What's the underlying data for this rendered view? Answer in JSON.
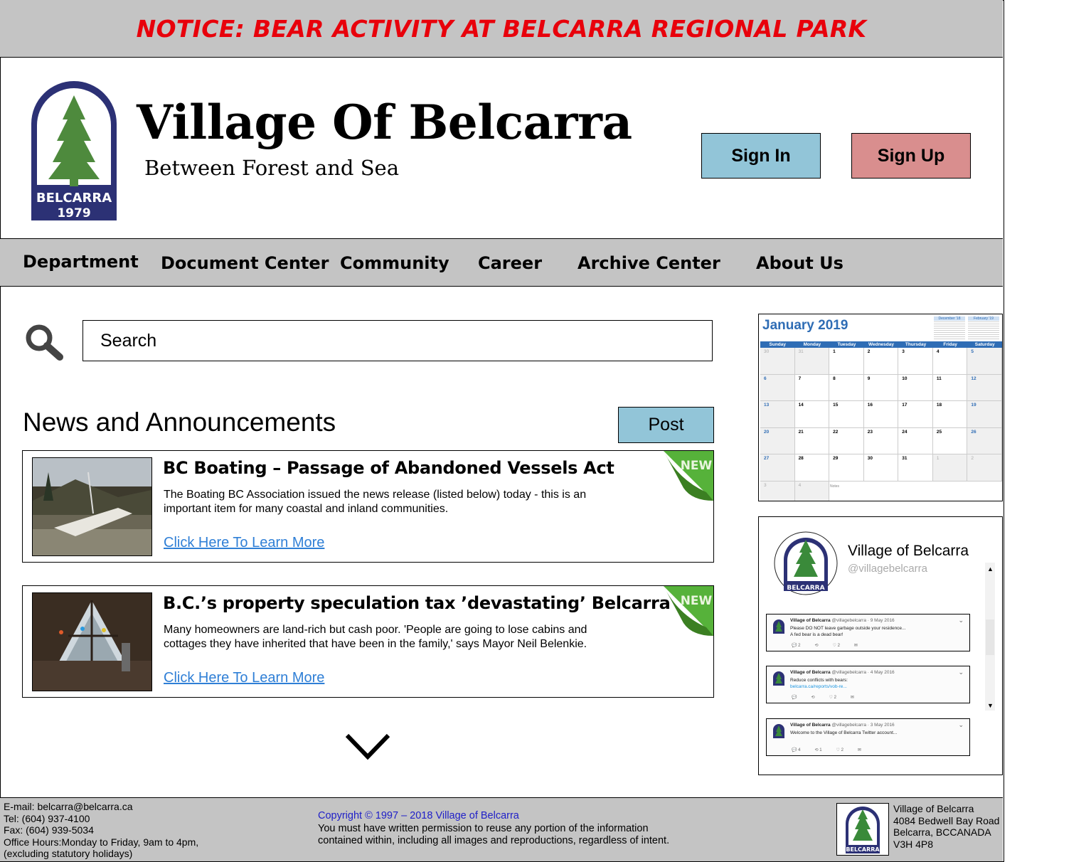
{
  "notice": {
    "text": "NOTICE: BEAR ACTIVITY AT BELCARRA REGIONAL PARK",
    "color": "#e8000b"
  },
  "header": {
    "logo": {
      "icon": "belcarra-crest-logo",
      "text_line1": "BELCARRA",
      "text_line2": "1979"
    },
    "title": "Village Of Belcarra",
    "tagline": "Between Forest and Sea",
    "sign_in": "Sign In",
    "sign_up": "Sign Up"
  },
  "nav": {
    "items": [
      "Department",
      "Document Center",
      "Community",
      "Career",
      "Archive Center",
      "About Us"
    ]
  },
  "search": {
    "placeholder": "Search",
    "icon": "search-icon"
  },
  "news": {
    "title": "News and Announcements",
    "post_label": "Post",
    "items": [
      {
        "headline": "BC Boating – Passage of Abandoned Vessels Act",
        "body": "The Boating BC Association issued the news release (listed below) today - this is an important item for many coastal and inland communities.",
        "link": "Click Here To Learn More",
        "badge": "NEW"
      },
      {
        "headline": "B.C.’s property speculation tax ’devastating’ Belcarra",
        "body": "Many homeowners are land-rich but cash poor. 'People are going to lose cabins and cottages they have inherited that have been in the family,' says Mayor Neil Belenkie.",
        "link": "Click Here To Learn More",
        "badge": "NEW"
      }
    ]
  },
  "calendar": {
    "month": "January 2019",
    "mini": [
      "December '18",
      "February '19"
    ],
    "weekdays": [
      "Sunday",
      "Monday",
      "Tuesday",
      "Wednesday",
      "Thursday",
      "Friday",
      "Saturday"
    ],
    "days": [
      "30",
      "31",
      "1",
      "2",
      "3",
      "4",
      "5",
      "6",
      "7",
      "8",
      "9",
      "10",
      "11",
      "12",
      "13",
      "14",
      "15",
      "16",
      "17",
      "18",
      "19",
      "20",
      "21",
      "22",
      "23",
      "24",
      "25",
      "26",
      "27",
      "28",
      "29",
      "30",
      "31",
      "1",
      "2",
      "3",
      "4"
    ],
    "notes": "Notes"
  },
  "twitter": {
    "name": "Village of Belcarra",
    "handle": "@villagebelcarra",
    "tweets": [
      {
        "author": "Village of Belcarra",
        "meta": "@villagebelcarra · 9 May 2016",
        "line1": "Please DO NOT leave garbage outside your residence...",
        "line2": "A fed bear is a dead bear!",
        "url": "",
        "replies": "2",
        "retweets": "",
        "likes": "2"
      },
      {
        "author": "Village of Belcarra",
        "meta": "@villagebelcarra · 4 May 2016",
        "line1": "Reduce conflicts with bears:",
        "line2": "",
        "url": "belcarra.ca/reports/vob-re...",
        "replies": "",
        "retweets": "",
        "likes": "2"
      },
      {
        "author": "Village of Belcarra",
        "meta": "@villagebelcarra · 3 May 2016",
        "line1": "Welcome to the Village of Belcarra Twitter account...",
        "line2": "",
        "url": "",
        "replies": "4",
        "retweets": "1",
        "likes": "2"
      }
    ]
  },
  "footer": {
    "email": "E-mail: belcarra@belcarra.ca",
    "tel": "Tel: (604) 937-4100",
    "fax": "Fax: (604) 939-5034",
    "hours": "Office Hours:Monday to Friday, 9am to 4pm,",
    "hours_note": "(excluding statutory holidays)",
    "copyright": "Copyright © 1997 – 2018 Village of Belcarra",
    "permission_line1": "You must have written permission to reuse any portion of the information",
    "permission_line2": "contained within, including all images and reproductions, regardless of intent.",
    "address_line1": "Village of Belcarra",
    "address_line2": "4084 Bedwell Bay Road",
    "address_line3": "Belcarra, BCCANADA",
    "address_line4": "V3H 4P8",
    "logo_text": "BELCARRA"
  },
  "colors": {
    "banner_gray": "#c4c4c4",
    "sign_in": "#92c5d8",
    "sign_up": "#d98e8e",
    "link": "#2f7fd6",
    "calendar_blue": "#2f6db5",
    "crest_navy": "#2c3175",
    "crest_green": "#4e8a3d"
  }
}
